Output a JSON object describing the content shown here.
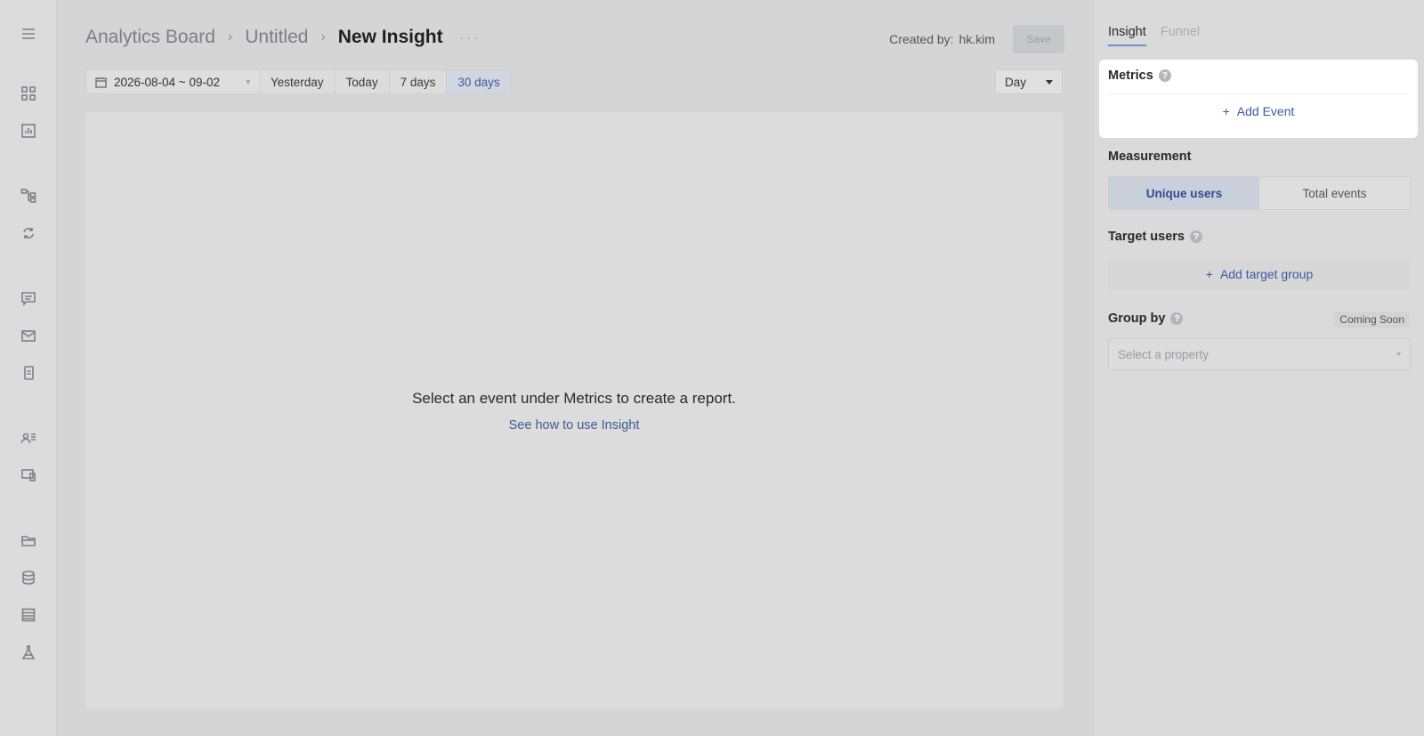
{
  "rail": {
    "icons": [
      "menu-icon",
      "dashboard-icon",
      "chart-icon",
      "flow-icon",
      "refresh-icon",
      "message-icon",
      "mail-icon",
      "mobile-icon",
      "user-list-icon",
      "device-icon",
      "folder-icon",
      "database-icon",
      "table-icon",
      "flask-icon"
    ]
  },
  "header": {
    "breadcrumb": [
      "Analytics Board",
      "Untitled",
      "New Insight"
    ],
    "more_label": "···",
    "created_by_label": "Created by:",
    "created_by_user": "hk.kim",
    "save_label": "Save"
  },
  "datebar": {
    "range": "2026-08-04 ~ 09-02",
    "quick": [
      "Yesterday",
      "Today",
      "7 days",
      "30 days"
    ],
    "active_quick": "30 days",
    "granularity": "Day"
  },
  "canvas": {
    "empty_message": "Select an event under Metrics to create a report.",
    "help_link": "See how to use Insight"
  },
  "panel": {
    "tabs": [
      "Insight",
      "Funnel"
    ],
    "active_tab": "Insight",
    "metrics": {
      "title": "Metrics",
      "add_event": "Add Event"
    },
    "measurement": {
      "title": "Measurement",
      "options": [
        "Unique users",
        "Total events"
      ],
      "selected": "Unique users"
    },
    "target": {
      "title": "Target users",
      "add_label": "Add target group"
    },
    "group_by": {
      "title": "Group by",
      "badge": "Coming Soon",
      "placeholder": "Select a property"
    }
  },
  "colors": {
    "accent": "#3d5a9e",
    "tab_underline": "#6f8ccf"
  }
}
